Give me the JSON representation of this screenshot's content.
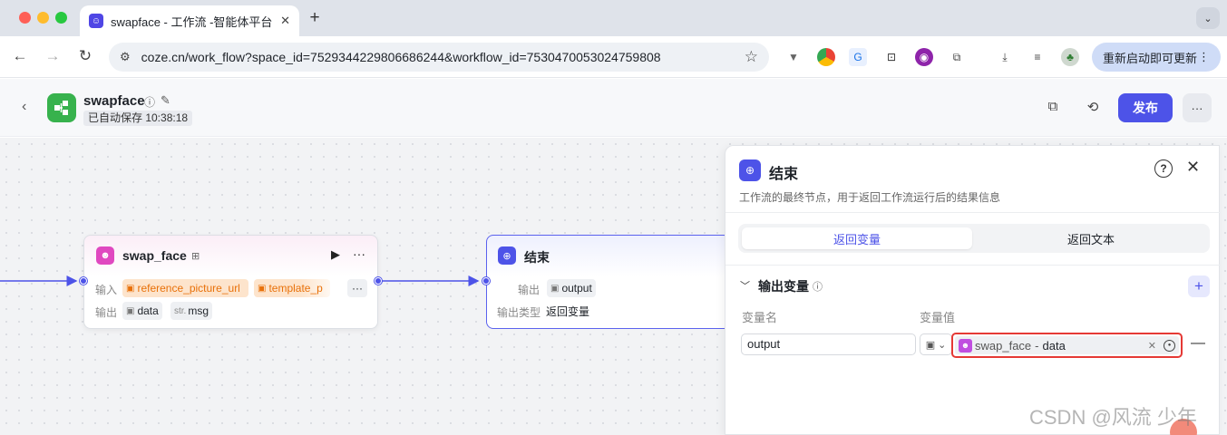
{
  "browser": {
    "tab_title": "swapface - 工作流 -智能体平台",
    "tab_close": "✕",
    "new_tab": "+",
    "url": "coze.cn/work_flow?space_id=7529344229806686244&workflow_id=7530470053024759808",
    "update_button": "重新启动即可更新",
    "icons": [
      "back-arrow-icon",
      "forward-arrow-icon",
      "reload-icon",
      "site-settings-icon",
      "bookmark-star-icon",
      "download-icon",
      "media-icon",
      "kebab-menu-icon"
    ]
  },
  "app": {
    "name": "swapface",
    "save_status": "已自动保存 10:38:18",
    "publish_label": "发布",
    "more_label": "···"
  },
  "nodes": {
    "swap_face": {
      "title": "swap_face",
      "input_label": "输入",
      "output_label": "输出",
      "inputs": [
        "reference_picture_url",
        "template_p"
      ],
      "overflow": "···",
      "outputs": [
        {
          "type": "image",
          "name": "data"
        },
        {
          "type": "str.",
          "name": "msg"
        }
      ]
    },
    "end": {
      "title": "结束",
      "output_label": "输出",
      "output_var": "output",
      "output_type_label": "输出类型",
      "output_type_value": "返回变量"
    }
  },
  "panel": {
    "title": "结束",
    "description": "工作流的最终节点，用于返回工作流运行后的结果信息",
    "tabs": [
      "返回变量",
      "返回文本"
    ],
    "active_tab": 0,
    "section_title": "输出变量",
    "col_name": "变量名",
    "col_value": "变量值",
    "var_name": "output",
    "ref_node": "swap_face",
    "ref_sep": "-",
    "ref_var": "data",
    "add_label": "+",
    "remove_label": "—"
  },
  "watermark": "CSDN @风流 少年",
  "colors": {
    "accent": "#4d53e8",
    "highlight_border": "#e53935",
    "app_logo": "#37b24d",
    "node_icon_pink": "#c04ee0"
  }
}
